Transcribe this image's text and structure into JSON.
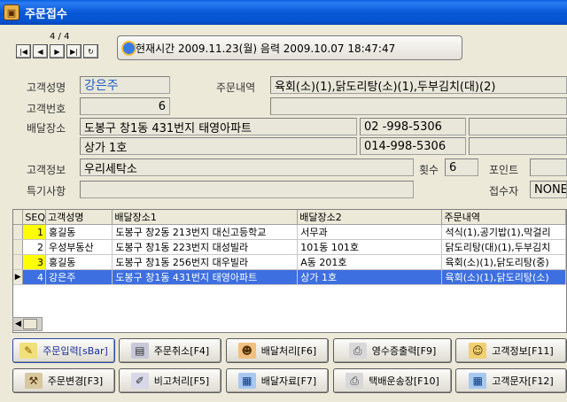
{
  "window": {
    "title": "주문접수"
  },
  "nav": {
    "record_counter": "4 / 4",
    "first": "|◀",
    "prev": "◀",
    "next": "▶",
    "last": "▶|",
    "refresh": "↻"
  },
  "clock": {
    "text": "현재시간  2009.11.23(월) 음력 2009.10.07 18:47:47"
  },
  "form": {
    "customer_name_label": "고객성명",
    "customer_name": "강은주",
    "order_detail_label": "주문내역",
    "order_detail": "육회(소)(1),닭도리탕(소)(1),두부김치(대)(2)",
    "customer_no_label": "고객번호",
    "customer_no": "6",
    "delivery_label": "배달장소",
    "address1": "도봉구 창1동 431번지 태영아파트",
    "phone1": "02  -998-5306",
    "address2": "상가 1호",
    "phone2": "014-998-5306",
    "customer_info_label": "고객정보",
    "customer_info": "우리세탁소",
    "count_label": "횟수",
    "count": "6",
    "point_label": "포인트",
    "notes_label": "특기사항",
    "notes": "",
    "receiver_label": "접수자",
    "receiver": "NONE"
  },
  "grid": {
    "columns": [
      "SEQ",
      "고객성명",
      "배달장소1",
      "배달장소2",
      "주문내역"
    ],
    "rows": [
      {
        "seq": "1",
        "name": "홍길동",
        "addr1": "도봉구 창2동 213번지 대신고등학교",
        "addr2": "서무과",
        "order": "석식(1),공기밥(1),막걸리"
      },
      {
        "seq": "2",
        "name": "우성부동산",
        "addr1": "도봉구 창1동 223번지 대성빌라",
        "addr2": "101동 101호",
        "order": "닭도리탕(대)(1),두부김치"
      },
      {
        "seq": "3",
        "name": "홍길동",
        "addr1": "도봉구 창1동 256번지 대우빌라",
        "addr2": "A동 201호",
        "order": "육회(소)(1),닭도리탕(중)"
      },
      {
        "seq": "4",
        "name": "강은주",
        "addr1": "도봉구 창1동 431번지 태영아파트",
        "addr2": "상가 1호",
        "order": "육회(소)(1),닭도리탕(소)"
      }
    ]
  },
  "buttons": {
    "order_input": "주문입력[sBar]",
    "order_cancel": "주문취소[F4]",
    "delivery": "배달처리[F6]",
    "receipt": "영수증출력[F9]",
    "customer_info": "고객정보[F11]",
    "order_change": "주문변경[F3]",
    "note": "비고처리[F5]",
    "delivery_data": "배달자료[F7]",
    "courier": "택배운송장[F10]",
    "customer_sms": "고객문자[F12]"
  }
}
